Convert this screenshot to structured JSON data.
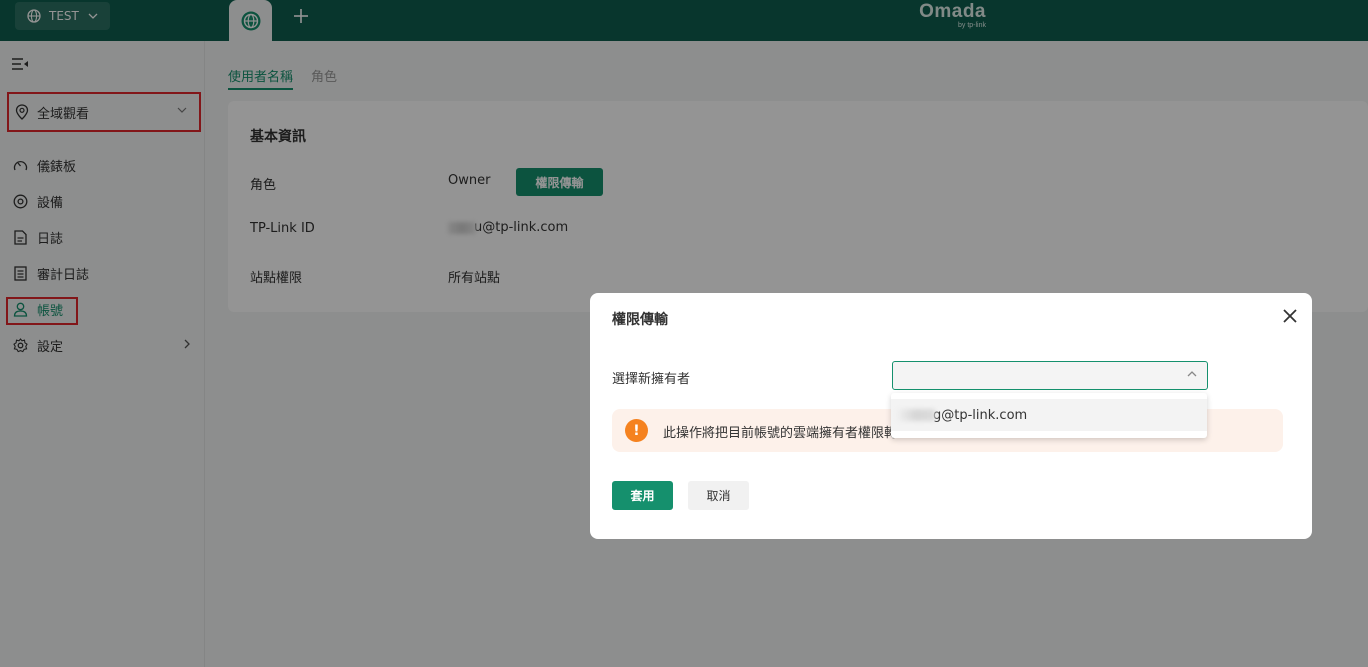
{
  "topbar": {
    "site_label": "TEST",
    "brand_name": "Omada",
    "brand_sub": "by tp-link"
  },
  "sidebar": {
    "scope_label": "全域觀看",
    "items": [
      {
        "label": "儀錶板",
        "icon": "dashboard-icon"
      },
      {
        "label": "設備",
        "icon": "device-icon"
      },
      {
        "label": "日誌",
        "icon": "log-icon"
      },
      {
        "label": "審計日誌",
        "icon": "audit-log-icon"
      },
      {
        "label": "帳號",
        "icon": "user-icon"
      },
      {
        "label": "設定",
        "icon": "settings-icon"
      }
    ]
  },
  "main": {
    "tabs": [
      {
        "label": "使用者名稱",
        "active": true
      },
      {
        "label": "角色",
        "active": false
      }
    ],
    "card": {
      "title": "基本資訊",
      "rows": [
        {
          "label": "角色",
          "value": "Owner"
        },
        {
          "label": "TP-Link ID",
          "value": "u@tp-link.com"
        },
        {
          "label": "站點權限",
          "value": "所有站點"
        }
      ],
      "transfer_button": "權限傳輸"
    }
  },
  "modal": {
    "title": "權限傳輸",
    "field_label": "選擇新擁有者",
    "select_value": "",
    "dropdown_option": "g@tp-link.com",
    "warning_text": "此操作將把目前帳號的雲端擁有者權限轉",
    "apply_label": "套用",
    "cancel_label": "取消"
  },
  "colors": {
    "topbar": "#0e5e4f",
    "accent": "#15906d",
    "warning": "#f5821f",
    "highlight_box": "#e0262b"
  }
}
